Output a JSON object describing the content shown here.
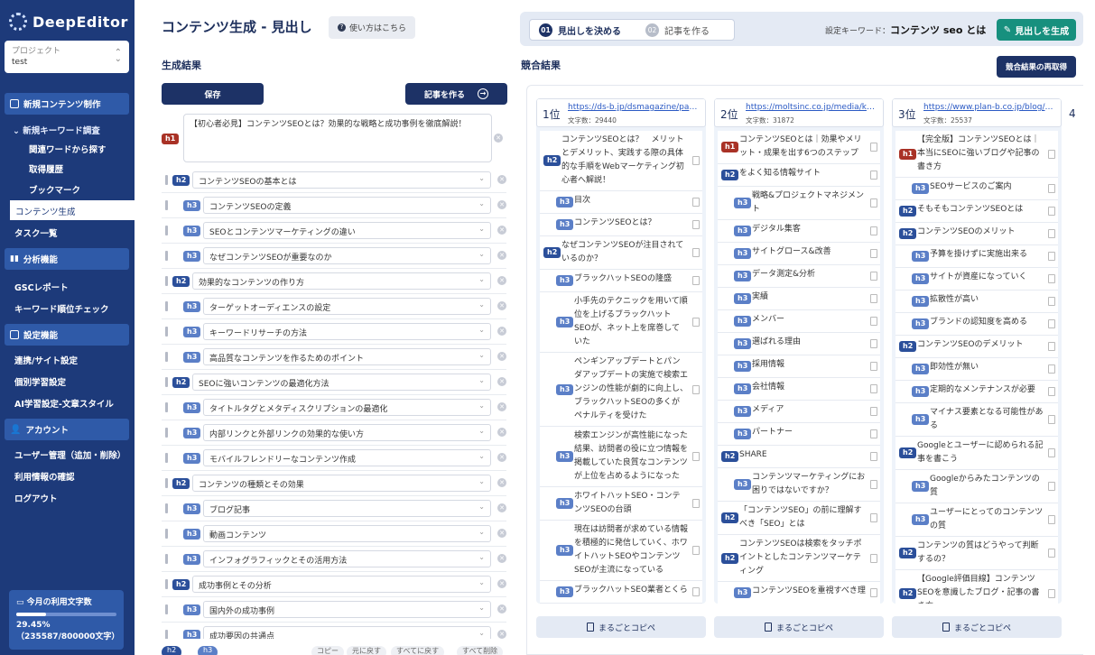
{
  "sidebar": {
    "logo": "DeepEditor",
    "project_label": "プロジェクト",
    "project_value": "test",
    "sections": [
      {
        "label": "新規コンテンツ制作"
      },
      {
        "label": "分析機能"
      },
      {
        "label": "設定機能"
      },
      {
        "label": "アカウント"
      }
    ],
    "items": {
      "keyword_research": "新規キーワード調査",
      "related_words": "関連ワードから探す",
      "history": "取得履歴",
      "bookmark": "ブックマーク",
      "content_gen": "コンテンツ生成",
      "task_list": "タスク一覧",
      "gsc_report": "GSCレポート",
      "rank_check": "キーワード順位チェック",
      "site_settings": "連携/サイト設定",
      "personal_learning": "個別学習設定",
      "ai_style": "AI学習設定-文章スタイル",
      "user_mgmt": "ユーザー管理（追加・削除）",
      "usage_info": "利用情報の確認",
      "logout": "ログアウト"
    },
    "usage": {
      "title": "今月の利用文字数",
      "percent": "29.45%",
      "fill_fraction": 0.2945,
      "detail": "（235587/800000文字）"
    }
  },
  "left": {
    "title": "コンテンツ生成 - 見出し",
    "help": "使い方はこちら",
    "result_label": "生成結果",
    "save": "保存",
    "write_article": "記事を作る",
    "h1_text": "【初心者必見】コンテンツSEOとは？効果的な戦略と成功事例を徹底解説！",
    "outline": [
      {
        "level": "h2",
        "text": "コンテンツSEOの基本とは"
      },
      {
        "level": "h3",
        "text": "コンテンツSEOの定義"
      },
      {
        "level": "h3",
        "text": "SEOとコンテンツマーケティングの違い"
      },
      {
        "level": "h3",
        "text": "なぜコンテンツSEOが重要なのか"
      },
      {
        "level": "h2",
        "text": "効果的なコンテンツの作り方"
      },
      {
        "level": "h3",
        "text": "ターゲットオーディエンスの設定"
      },
      {
        "level": "h3",
        "text": "キーワードリサーチの方法"
      },
      {
        "level": "h3",
        "text": "高品質なコンテンツを作るためのポイント"
      },
      {
        "level": "h2",
        "text": "SEOに強いコンテンツの最適化方法"
      },
      {
        "level": "h3",
        "text": "タイトルタグとメタディスクリプションの最適化"
      },
      {
        "level": "h3",
        "text": "内部リンクと外部リンクの効果的な使い方"
      },
      {
        "level": "h3",
        "text": "モバイルフレンドリーなコンテンツ作成"
      },
      {
        "level": "h2",
        "text": "コンテンツの種類とその効果"
      },
      {
        "level": "h3",
        "text": "ブログ記事"
      },
      {
        "level": "h3",
        "text": "動画コンテンツ"
      },
      {
        "level": "h3",
        "text": "インフォグラフィックとその活用方法"
      },
      {
        "level": "h2",
        "text": "成功事例とその分析"
      },
      {
        "level": "h3",
        "text": "国内外の成功事例"
      },
      {
        "level": "h3",
        "text": "成功要因の共通点"
      }
    ],
    "bottom_buttons": [
      "h2",
      "h3",
      "コピー",
      "元に戻す",
      "すべてに戻す",
      "すべて削除"
    ]
  },
  "right": {
    "step1_num": "01",
    "step1": "見出しを決める",
    "step2_num": "02",
    "step2": "記事を作る",
    "kw_label": "設定キーワード：",
    "kw_value": "コンテンツ seo とは",
    "generate": "見出しを生成",
    "result_label": "競合結果",
    "refetch": "競合結果の再取得",
    "copy_all": "まるごとコピペ",
    "competitors": [
      {
        "rank": "1位",
        "url": "https://ds-b.jp/dsmagazine/pages/",
        "chars": "文字数：29440",
        "headings": [
          {
            "level": "h2",
            "text": "コンテンツSEOとは？　メリットとデメリット、実践する際の具体的な手順をWebマーケティング初心者へ解説！"
          },
          {
            "level": "h3",
            "text": "目次"
          },
          {
            "level": "h3",
            "text": "コンテンツSEOとは？"
          },
          {
            "level": "h2",
            "text": "なぜコンテンツSEOが注目されているのか？"
          },
          {
            "level": "h3",
            "text": "ブラックハットSEOの隆盛"
          },
          {
            "level": "h3",
            "text": "小手先のテクニックを用いて順位を上げるブラックハットSEOが、ネット上を席巻していた"
          },
          {
            "level": "h3",
            "text": "ペンギンアップデートとパンダアップデートの実施で検索エンジンの性能が劇的に向上し、ブラックハットSEOの多くがペナルティを受けた"
          },
          {
            "level": "h3",
            "text": "検索エンジンが高性能になった結果、訪問者の役に立つ情報を掲載していた良質なコンテンツが上位を占めるようになった"
          },
          {
            "level": "h3",
            "text": "ホワイトハットSEO・コンテンツSEOの台頭"
          },
          {
            "level": "h3",
            "text": "現在は訪問者が求めている情報を積極的に発信していく、ホワイトハットSEOやコンテンツSEOが主流になっている"
          },
          {
            "level": "h3",
            "text": "ブラックハットSEO業者とくら"
          }
        ]
      },
      {
        "rank": "2位",
        "url": "https://moltsinc.co.jp/media/knowhow/",
        "chars": "文字数：31872",
        "headings": [
          {
            "level": "h1",
            "text": "コンテンツSEOとは｜効果やメリット・成果を出す6つのステップ"
          },
          {
            "level": "h2",
            "text": "をよく知る情報サイト"
          },
          {
            "level": "h3",
            "text": "戦略&プロジェクトマネジメント"
          },
          {
            "level": "h3",
            "text": "デジタル集客"
          },
          {
            "level": "h3",
            "text": "サイトグロース&改善"
          },
          {
            "level": "h3",
            "text": "データ測定&分析"
          },
          {
            "level": "h3",
            "text": "実績"
          },
          {
            "level": "h3",
            "text": "メンバー"
          },
          {
            "level": "h3",
            "text": "選ばれる理由"
          },
          {
            "level": "h3",
            "text": "採用情報"
          },
          {
            "level": "h3",
            "text": "会社情報"
          },
          {
            "level": "h3",
            "text": "メディア"
          },
          {
            "level": "h3",
            "text": "パートナー"
          },
          {
            "level": "h2",
            "text": "SHARE"
          },
          {
            "level": "h3",
            "text": "コンテンツマーケティングにお困りではないですか？"
          },
          {
            "level": "h2",
            "text": "「コンテンツSEO」の前に理解すべき「SEO」とは"
          },
          {
            "level": "h2",
            "text": "コンテンツSEOは検索をタッチポイントとしたコンテンツマーケティング"
          },
          {
            "level": "h3",
            "text": "コンテンツSEOを重視すべき理"
          }
        ]
      },
      {
        "rank": "3位",
        "url": "https://www.plan-b.co.jp/blog/seo/",
        "chars": "文字数：25537",
        "headings": [
          {
            "level": "h1",
            "text": "【完全版】コンテンツSEOとは｜本当にSEOに強いブログや記事の書き方"
          },
          {
            "level": "h3",
            "text": "SEOサービスのご案内"
          },
          {
            "level": "h2",
            "text": "そもそもコンテンツSEOとは"
          },
          {
            "level": "h2",
            "text": "コンテンツSEOのメリット"
          },
          {
            "level": "h3",
            "text": "予算を掛けずに実施出来る"
          },
          {
            "level": "h3",
            "text": "サイトが資産になっていく"
          },
          {
            "level": "h3",
            "text": "拡散性が高い"
          },
          {
            "level": "h3",
            "text": "ブランドの認知度を高める"
          },
          {
            "level": "h2",
            "text": "コンテンツSEOのデメリット"
          },
          {
            "level": "h3",
            "text": "即効性が無い"
          },
          {
            "level": "h3",
            "text": "定期的なメンテナンスが必要"
          },
          {
            "level": "h3",
            "text": "マイナス要素となる可能性がある"
          },
          {
            "level": "h2",
            "text": "Googleとユーザーに認められる記事を書こう"
          },
          {
            "level": "h3",
            "text": "Googleからみたコンテンツの質"
          },
          {
            "level": "h3",
            "text": "ユーザーにとってのコンテンツの質"
          },
          {
            "level": "h2",
            "text": "コンテンツの質はどうやって判断するの？"
          },
          {
            "level": "h2",
            "text": "【Google評価目線】コンテンツSEOを意識したブログ・記事の書き方"
          }
        ]
      }
    ],
    "partial_rank": "4"
  },
  "colors": {
    "sidebar": "#1d3a7a",
    "primary": "#1d3266",
    "accent_green": "#17907e",
    "h1_tag": "#a93226",
    "h2_tag": "#2b4f9a",
    "h3_tag": "#5b7fc7"
  }
}
